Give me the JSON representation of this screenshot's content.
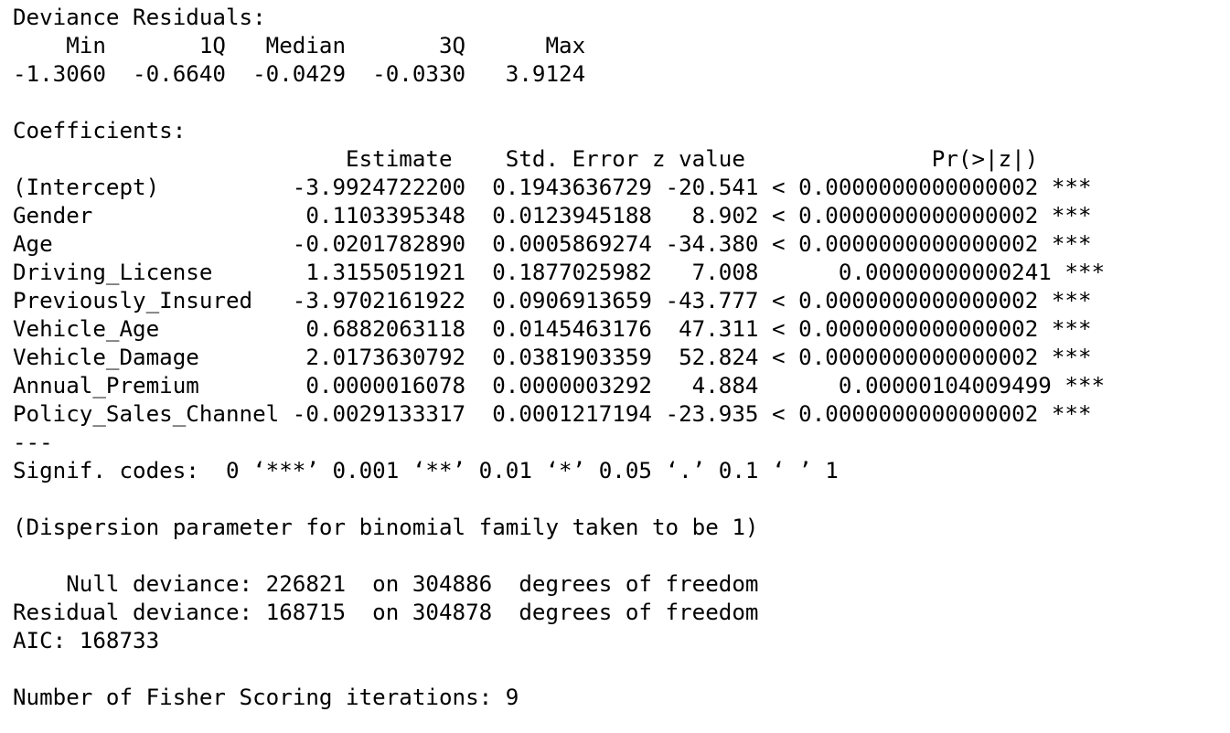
{
  "deviance_residuals": {
    "title": "Deviance Residuals:",
    "header": "    Min       1Q   Median       3Q      Max  ",
    "values": "-1.3060  -0.6640  -0.0429  -0.0330   3.9124  "
  },
  "coefficients": {
    "title": "Coefficients:",
    "header": "                         Estimate    Std. Error z value              Pr(>|z|)    ",
    "rows": [
      "(Intercept)          -3.9924722200  0.1943636729 -20.541 < 0.0000000000000002 ***",
      "Gender                0.1103395348  0.0123945188   8.902 < 0.0000000000000002 ***",
      "Age                  -0.0201782890  0.0005869274 -34.380 < 0.0000000000000002 ***",
      "Driving_License       1.3155051921  0.1877025982   7.008      0.00000000000241 ***",
      "Previously_Insured   -3.9702161922  0.0906913659 -43.777 < 0.0000000000000002 ***",
      "Vehicle_Age           0.6882063118  0.0145463176  47.311 < 0.0000000000000002 ***",
      "Vehicle_Damage        2.0173630792  0.0381903359  52.824 < 0.0000000000000002 ***",
      "Annual_Premium        0.0000016078  0.0000003292   4.884      0.00000104009499 ***",
      "Policy_Sales_Channel -0.0029133317  0.0001217194 -23.935 < 0.0000000000000002 ***"
    ]
  },
  "separator": "---",
  "signif_codes": "Signif. codes:  0 ‘***’ 0.001 ‘**’ 0.01 ‘*’ 0.05 ‘.’ 0.1 ‘ ’ 1",
  "dispersion": "(Dispersion parameter for binomial family taken to be 1)",
  "deviance": {
    "null": "    Null deviance: 226821  on 304886  degrees of freedom",
    "residual": "Residual deviance: 168715  on 304878  degrees of freedom",
    "aic": "AIC: 168733"
  },
  "iterations": "Number of Fisher Scoring iterations: 9"
}
